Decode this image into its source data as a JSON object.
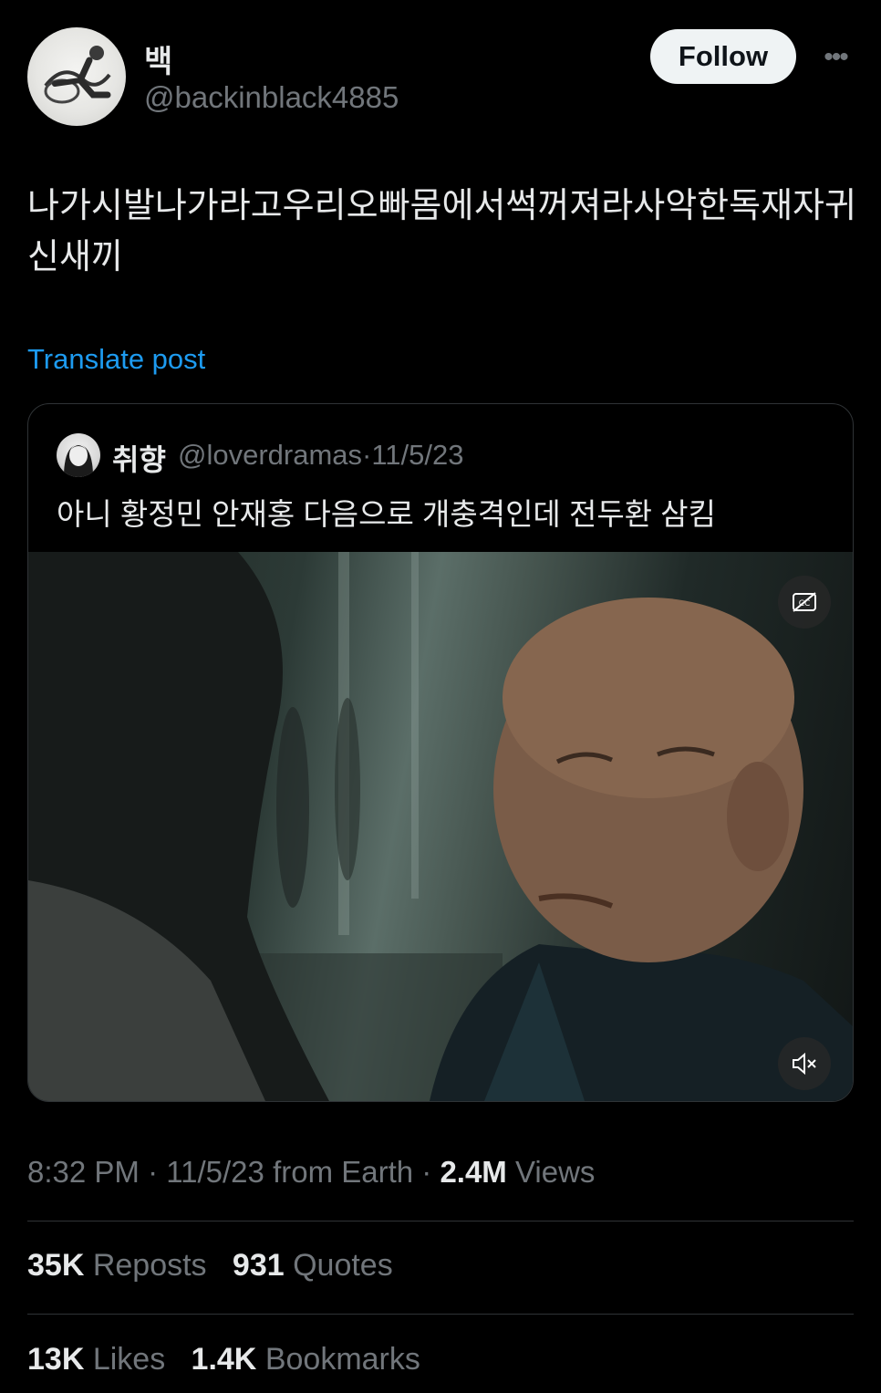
{
  "author": {
    "display_name": "백",
    "handle": "@backinblack4885",
    "follow_label": "Follow"
  },
  "post": {
    "text": "나가시발나가라고우리오빠몸에서썩꺼져라사악한독재자귀신새끼",
    "translate_label": "Translate post"
  },
  "quote": {
    "display_name": "취향",
    "handle": "@loverdramas",
    "separator": "·",
    "date": "11/5/23",
    "text": "아니 황정민 안재홍 다음으로 개충격인데 전두환 삼킴"
  },
  "meta": {
    "time": "8:32 PM",
    "date": "11/5/23",
    "source": "from Earth",
    "views_count": "2.4M",
    "views_label": "Views"
  },
  "stats": {
    "reposts_count": "35K",
    "reposts_label": "Reposts",
    "quotes_count": "931",
    "quotes_label": "Quotes",
    "likes_count": "13K",
    "likes_label": "Likes",
    "bookmarks_count": "1.4K",
    "bookmarks_label": "Bookmarks"
  },
  "icons": {
    "more": "more-horizontal-icon",
    "captions": "captions-off-icon",
    "mute": "volume-muted-icon"
  },
  "colors": {
    "background": "#000000",
    "text_primary": "#e7e9ea",
    "text_secondary": "#71767b",
    "link": "#1d9bf0",
    "border": "#2f3336",
    "follow_bg": "#eff3f4"
  }
}
